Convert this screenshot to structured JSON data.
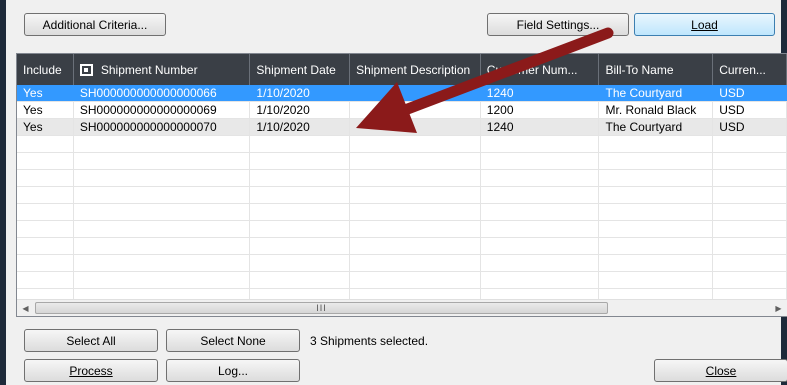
{
  "toolbar": {
    "additional_criteria_label": "Additional Criteria...",
    "field_settings_label": "Field Settings...",
    "load_label": "Load"
  },
  "grid": {
    "columns": [
      "Include",
      "Shipment Number",
      "Shipment Date",
      "Shipment Description",
      "Customer Num...",
      "Bill-To Name",
      "Curren..."
    ],
    "rows": [
      {
        "include": "Yes",
        "shipment_number": "SH000000000000000066",
        "shipment_date": "1/10/2020",
        "shipment_description": "",
        "customer_number": "1240",
        "bill_to_name": "The Courtyard",
        "currency": "USD"
      },
      {
        "include": "Yes",
        "shipment_number": "SH000000000000000069",
        "shipment_date": "1/10/2020",
        "shipment_description": "",
        "customer_number": "1200",
        "bill_to_name": "Mr. Ronald Black",
        "currency": "USD"
      },
      {
        "include": "Yes",
        "shipment_number": "SH000000000000000070",
        "shipment_date": "1/10/2020",
        "shipment_description": "",
        "customer_number": "1240",
        "bill_to_name": "The Courtyard",
        "currency": "USD"
      }
    ],
    "scroll_thumb_label": "III"
  },
  "footer": {
    "select_all_label": "Select All",
    "select_none_label": "Select None",
    "status_text": "3 Shipments selected.",
    "process_label": "Process",
    "log_label": "Log...",
    "close_label": "Close"
  },
  "colors": {
    "selection": "#3399ff",
    "header_bg": "#3a3f46",
    "annotation_arrow": "#8b1a1a"
  }
}
